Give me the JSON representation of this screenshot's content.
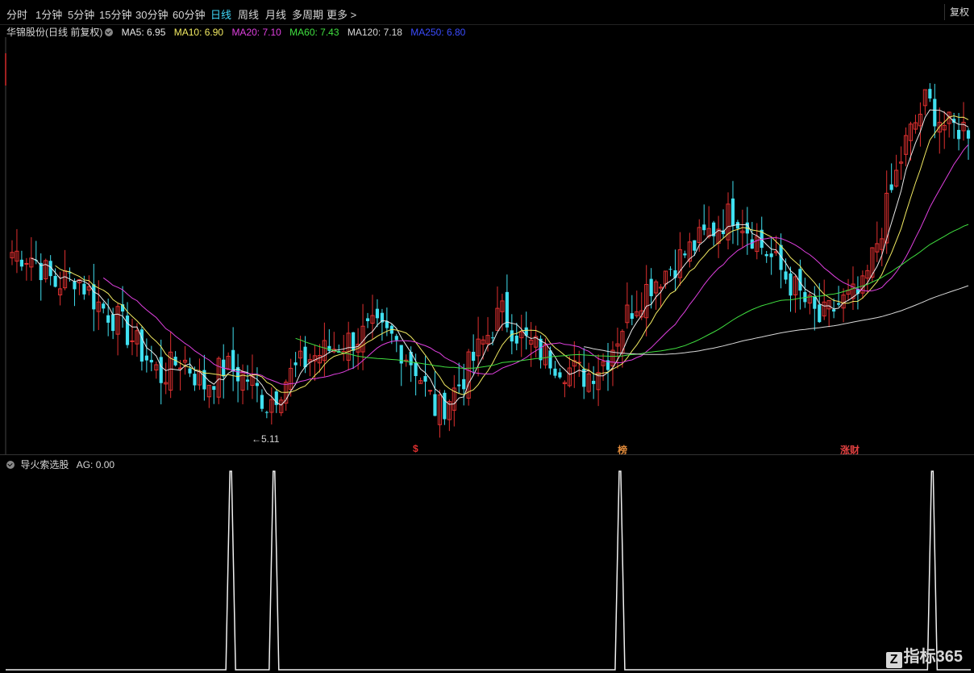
{
  "toolbar": {
    "periods": [
      "分时",
      "1分钟",
      "5分钟",
      "15分钟",
      "30分钟",
      "60分钟",
      "日线",
      "周线",
      "月线",
      "多周期",
      "更多 >"
    ],
    "active_index": 6,
    "fq_label": "复权"
  },
  "legend": {
    "stock": "华锦股份(日线 前复权)",
    "ma": [
      {
        "label": "MA5: 6.95",
        "color": "#e8e8e8"
      },
      {
        "label": "MA10: 6.90",
        "color": "#f2ea62"
      },
      {
        "label": "MA20: 7.10",
        "color": "#e040e0"
      },
      {
        "label": "MA60: 7.43",
        "color": "#40e040"
      },
      {
        "label": "MA120: 7.18",
        "color": "#d8d8d8"
      },
      {
        "label": "MA250: 6.80",
        "color": "#3b4cff"
      }
    ]
  },
  "low_label": "←5.11",
  "tags": [
    {
      "text": "$",
      "color": "#e03030"
    },
    {
      "text": "榜",
      "color": "#e08a3a"
    },
    {
      "text": "涨财",
      "color": "#e04040"
    }
  ],
  "sub_indicator": {
    "name": "导火索选股",
    "value_label": "AG: 0.00"
  },
  "watermark": {
    "logo": "Z",
    "text": "指标365"
  },
  "colors": {
    "up": "#e03030",
    "down": "#40e0f0",
    "bg": "#000000"
  },
  "chart_data": {
    "type": "candlestick",
    "series_close_anchors": [
      6.95,
      6.9,
      6.6,
      6.7,
      6.4,
      6.2,
      5.9,
      5.6,
      5.8,
      5.5,
      5.7,
      5.6,
      5.3,
      5.6,
      5.8,
      5.9,
      6.0,
      6.1,
      6.0,
      5.7,
      5.2,
      5.5,
      5.9,
      6.3,
      6.0,
      5.85,
      5.7,
      5.6,
      5.8,
      6.3,
      6.6,
      6.8,
      7.0,
      7.2,
      7.4,
      7.1,
      6.8,
      6.5,
      6.2,
      6.4,
      6.5,
      7.3,
      8.1,
      8.6,
      8.3,
      8.3
    ],
    "lowest": 5.11,
    "signals_at_fraction": [
      0.23,
      0.275,
      0.635,
      0.96
    ]
  }
}
